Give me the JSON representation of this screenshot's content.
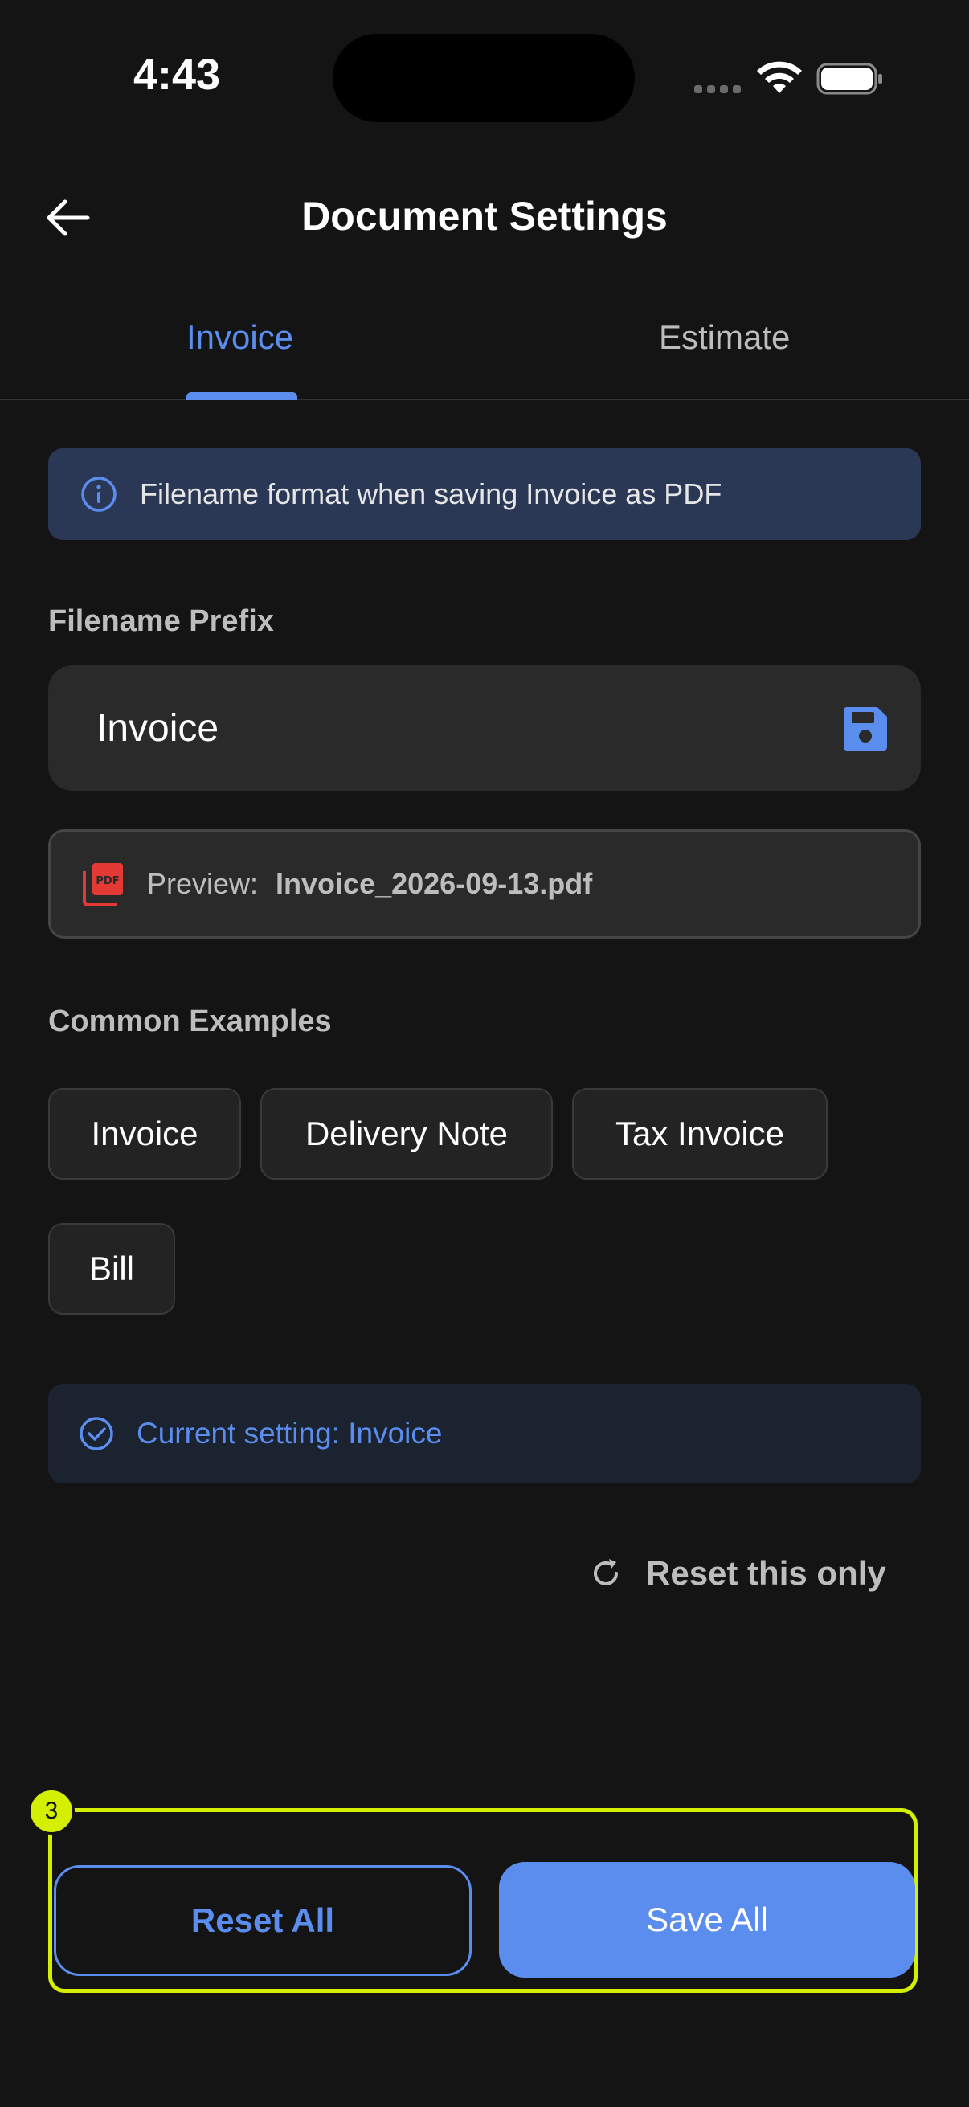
{
  "status_bar": {
    "time": "4:43"
  },
  "header": {
    "title": "Document Settings"
  },
  "tabs": [
    {
      "label": "Invoice",
      "selected": true
    },
    {
      "label": "Estimate",
      "selected": false
    }
  ],
  "info_banner": {
    "text": "Filename format when saving Invoice as PDF",
    "icon": "info-icon"
  },
  "filename_prefix": {
    "label": "Filename Prefix",
    "value": "Invoice",
    "icon": "save-icon"
  },
  "preview": {
    "label": "Preview:",
    "value": "Invoice_2026-09-13.pdf",
    "icon": "pdf-icon"
  },
  "examples": {
    "label": "Common Examples",
    "items": [
      "Invoice",
      "Delivery Note",
      "Tax Invoice",
      "Bill"
    ]
  },
  "current_setting": {
    "text": "Current setting: Invoice",
    "icon": "check-circle-icon"
  },
  "reset_this_only": {
    "label": "Reset this only",
    "icon": "refresh-icon"
  },
  "actions": {
    "badge": "3",
    "reset_all": "Reset All",
    "save_all": "Save All"
  },
  "colors": {
    "accent": "#5b8def",
    "background": "#141414",
    "highlight": "#d4f000",
    "pdf": "#e53935"
  }
}
